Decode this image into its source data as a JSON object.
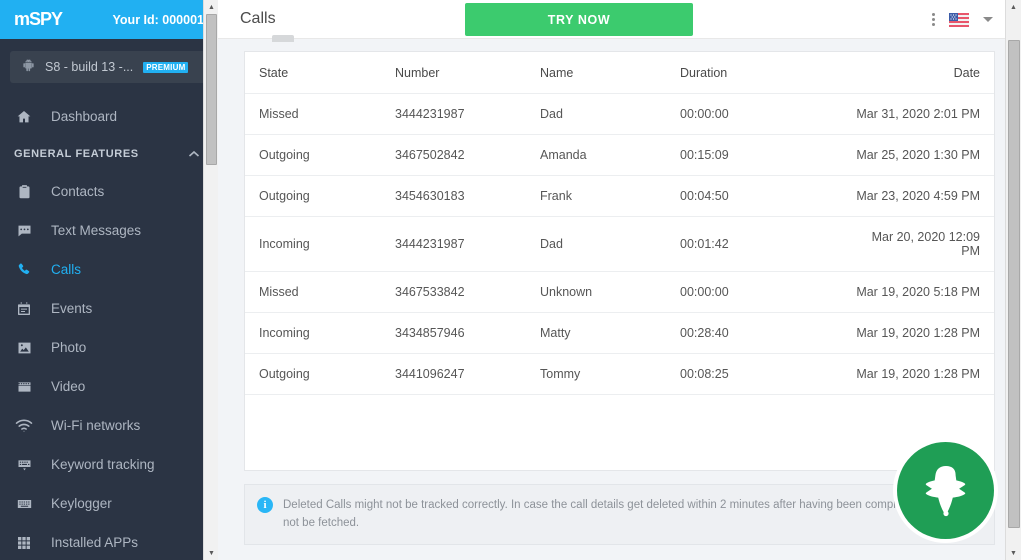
{
  "brand": {
    "logo_text": "mSPY",
    "user_id_label": "Your Id: 000001",
    "brand_color": "#21b0f2"
  },
  "device": {
    "name": "S8 - build 13 -...",
    "badge": "PREMIUM",
    "icon": "android-icon"
  },
  "sidebar": {
    "dashboard": {
      "label": "Dashboard",
      "icon": "home-icon"
    },
    "section_title": "GENERAL FEATURES",
    "section_toggle_icon": "chevron-up-icon",
    "items": [
      {
        "label": "Contacts",
        "icon": "contacts-clipboard-icon",
        "active": false
      },
      {
        "label": "Text Messages",
        "icon": "message-bubble-icon",
        "active": false
      },
      {
        "label": "Calls",
        "icon": "phone-icon",
        "active": true
      },
      {
        "label": "Events",
        "icon": "calendar-icon",
        "active": false
      },
      {
        "label": "Photo",
        "icon": "photo-icon",
        "active": false
      },
      {
        "label": "Video",
        "icon": "video-clapper-icon",
        "active": false
      },
      {
        "label": "Wi-Fi networks",
        "icon": "wifi-icon",
        "active": false
      },
      {
        "label": "Keyword tracking",
        "icon": "keyword-keyboard-icon",
        "active": false
      },
      {
        "label": "Keylogger",
        "icon": "keyboard-icon",
        "active": false
      },
      {
        "label": "Installed APPs",
        "icon": "grid-apps-icon",
        "active": false
      }
    ],
    "active_color": "#21b0f2"
  },
  "header": {
    "title": "Calls",
    "try_now_label": "TRY NOW",
    "try_now_color": "#3ccb6e",
    "kebab_icon": "more-vertical-icon",
    "flag_icon": "us-flag-icon",
    "caret_icon": "chevron-down-icon"
  },
  "table": {
    "columns": [
      "State",
      "Number",
      "Name",
      "Duration",
      "Date"
    ],
    "rows": [
      {
        "state": "Missed",
        "number": "3444231987",
        "name": "Dad",
        "duration": "00:00:00",
        "date": "Mar 31, 2020 2:01 PM"
      },
      {
        "state": "Outgoing",
        "number": "3467502842",
        "name": "Amanda",
        "duration": "00:15:09",
        "date": "Mar 25, 2020 1:30 PM"
      },
      {
        "state": "Outgoing",
        "number": "3454630183",
        "name": "Frank",
        "duration": "00:04:50",
        "date": "Mar 23, 2020 4:59 PM"
      },
      {
        "state": "Incoming",
        "number": "3444231987",
        "name": "Dad",
        "duration": "00:01:42",
        "date": "Mar 20, 2020 12:09 PM"
      },
      {
        "state": "Missed",
        "number": "3467533842",
        "name": "Unknown",
        "duration": "00:00:00",
        "date": "Mar 19, 2020 5:18 PM"
      },
      {
        "state": "Incoming",
        "number": "3434857946",
        "name": "Matty",
        "duration": "00:28:40",
        "date": "Mar 19, 2020 1:28 PM"
      },
      {
        "state": "Outgoing",
        "number": "3441096247",
        "name": "Tommy",
        "duration": "00:08:25",
        "date": "Mar 19, 2020 1:28 PM"
      }
    ]
  },
  "notice": {
    "icon": "info-icon",
    "text": "Deleted Calls might not be tracked correctly. In case the call details get deleted within 2 minutes after having been completed, they might not be fetched."
  },
  "spy_badge": {
    "icon": "spy-detective-icon",
    "color": "#1f9e55"
  }
}
